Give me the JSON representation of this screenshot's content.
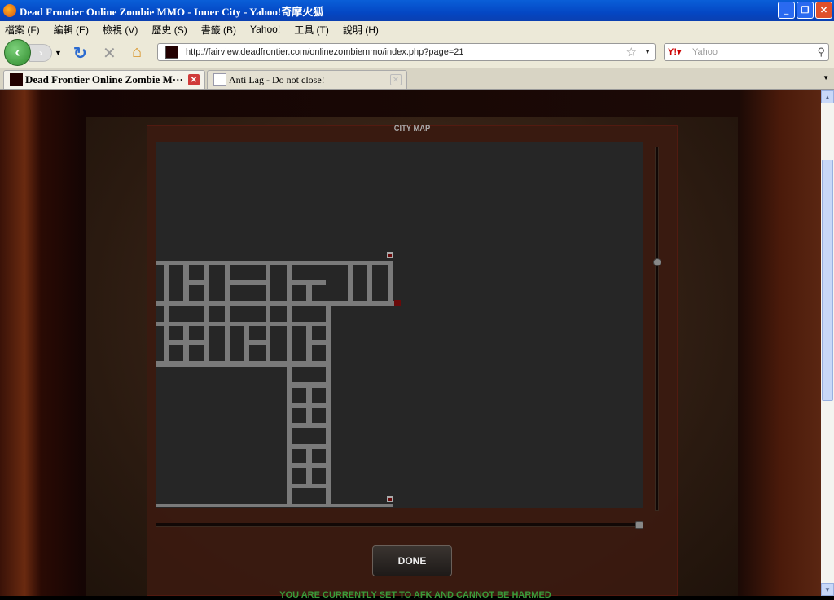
{
  "window": {
    "title": "Dead Frontier Online Zombie MMO - Inner City - Yahoo!奇摩火狐"
  },
  "menu": [
    "檔案 (F)",
    "編輯 (E)",
    "檢視 (V)",
    "歷史 (S)",
    "書籤 (B)",
    "Yahoo!",
    "工具 (T)",
    "說明 (H)"
  ],
  "nav": {
    "url": "http://fairview.deadfrontier.com/onlinezombiemmo/index.php?page=21",
    "search_placeholder": "Yahoo"
  },
  "tabs": [
    {
      "label": "Dead Frontier Online Zombie M···"
    },
    {
      "label": "Anti Lag - Do not close!"
    }
  ],
  "game": {
    "map_title": "CITY MAP",
    "done_label": "DONE",
    "status_text": "YOU ARE CURRENTLY SET TO AFK AND CANNOT BE HARMED"
  },
  "colors": {
    "road": "#7a7a7a",
    "map_bg": "#262626",
    "marker": "#6a0a0a",
    "afk_text": "#3a9a3a"
  }
}
